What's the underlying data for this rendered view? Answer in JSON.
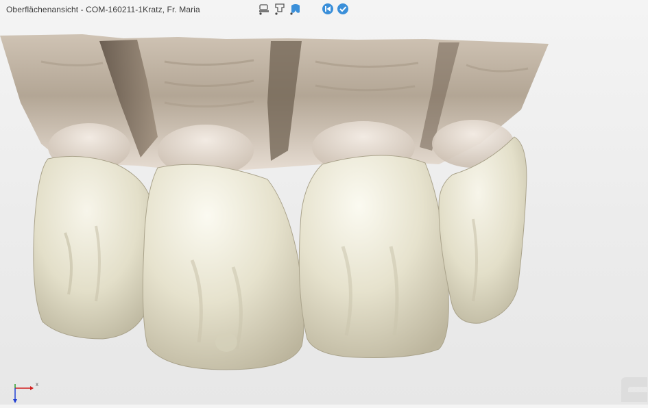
{
  "window": {
    "title": "Oberflächenansicht  - COM-160211-1Kratz, Fr. Maria"
  },
  "toolbar": {
    "tools": [
      {
        "icon": "articulator-lower-icon",
        "interactable": true
      },
      {
        "icon": "articulator-upper-icon",
        "interactable": true
      },
      {
        "icon": "tooth-model-icon",
        "interactable": true,
        "active": true
      },
      {
        "icon": "back-icon",
        "interactable": true
      },
      {
        "icon": "confirm-icon",
        "interactable": true
      }
    ],
    "accent_color": "#3a8fd9"
  },
  "viewport": {
    "axis_label_x": "x",
    "colors": {
      "gingiva": "#d9cdbf",
      "gingiva_shadow": "#8a7a6a",
      "tooth": "#e8e4d2",
      "tooth_shadow": "#bdb7a0",
      "background": "#efefef"
    }
  }
}
